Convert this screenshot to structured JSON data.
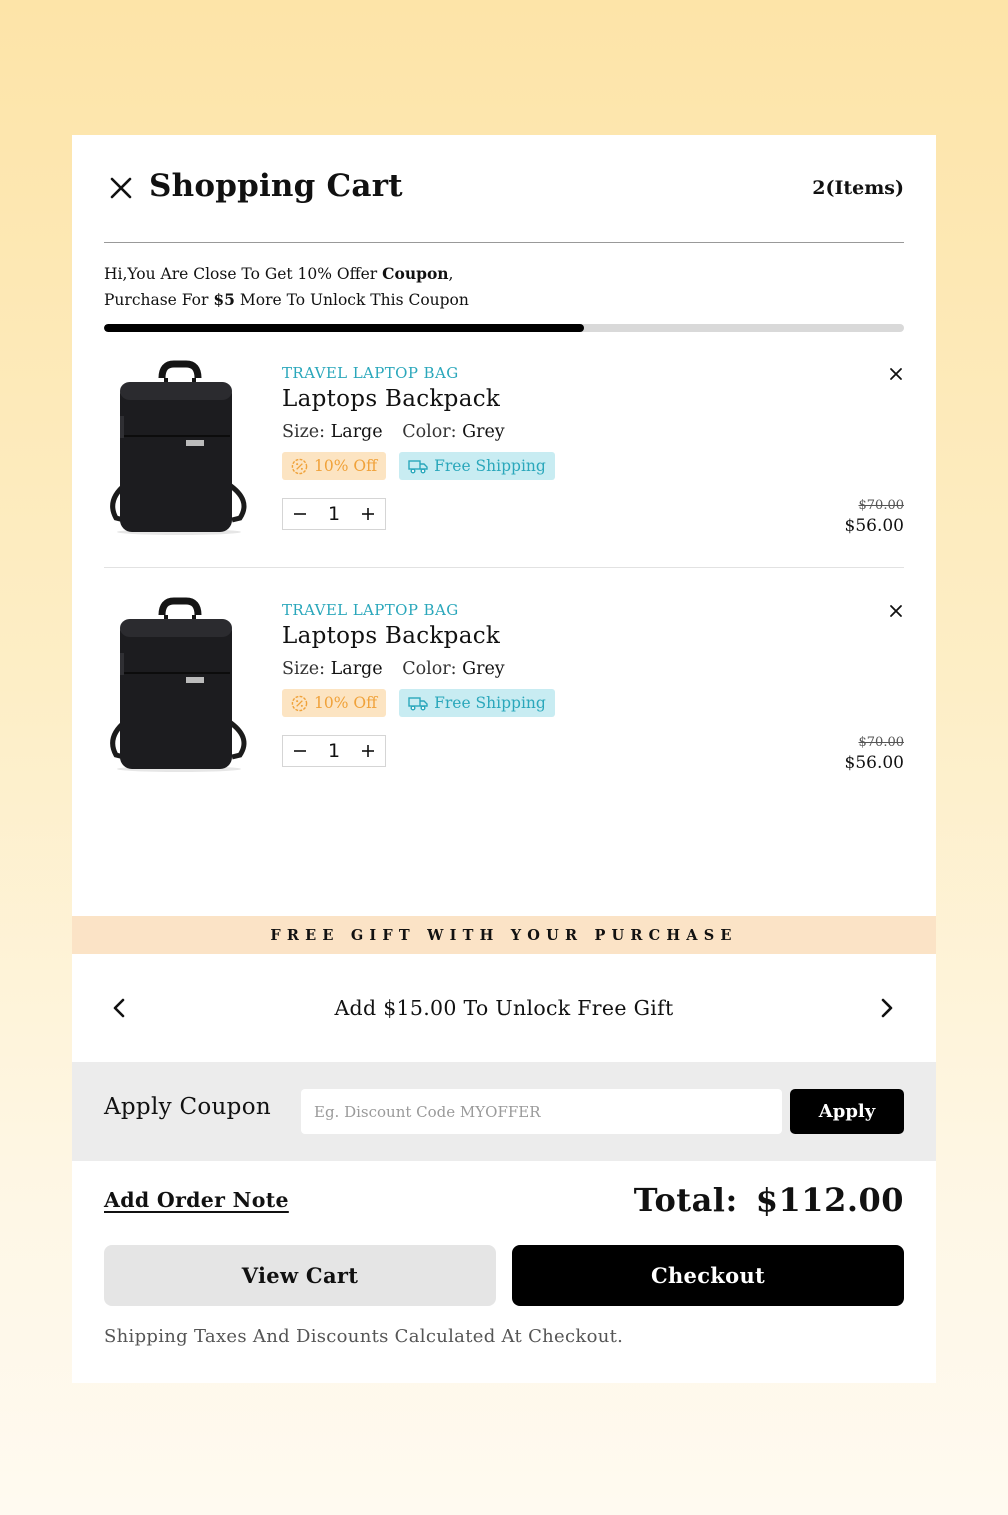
{
  "header": {
    "title": "Shopping Cart",
    "count": "2(Items)"
  },
  "promo": {
    "line1_prefix": "Hi,You Are Close To Get 10% Offer ",
    "line1_bold": "Coupon",
    "line1_suffix": ",",
    "line2_prefix": "Purchase For ",
    "line2_bold": "$5",
    "line2_suffix": " More To Unlock This Coupon",
    "progress": 0.6
  },
  "items": [
    {
      "category": "TRAVEL LAPTOP BAG",
      "name": "Laptops Backpack",
      "size_label": "Size:",
      "size": "Large",
      "color_label": "Color:",
      "color": "Grey",
      "badge_discount": "10% Off",
      "badge_shipping": "Free Shipping",
      "quantity": "1",
      "old_price": "$70.00",
      "price": "$56.00"
    },
    {
      "category": "TRAVEL LAPTOP BAG",
      "name": "Laptops Backpack",
      "size_label": "Size:",
      "size": "Large",
      "color_label": "Color:",
      "color": "Grey",
      "badge_discount": "10% Off",
      "badge_shipping": "Free Shipping",
      "quantity": "1",
      "old_price": "$70.00",
      "price": "$56.00"
    }
  ],
  "gift": {
    "banner": "FREE GIFT WITH YOUR PURCHASE",
    "message": "Add $15.00 To Unlock Free Gift"
  },
  "coupon": {
    "label": "Apply Coupon",
    "placeholder": "Eg. Discount Code MYOFFER",
    "button": "Apply"
  },
  "footer": {
    "note_link": "Add Order Note",
    "total_label": "Total:",
    "total_value": "$112.00",
    "view_cart": "View Cart",
    "checkout": "Checkout",
    "disclaimer": "Shipping Taxes And Discounts Calculated At Checkout."
  },
  "colors": {
    "accent_teal": "#2aa7bb",
    "discount_orange": "#f0a23a",
    "discount_bg": "#fce4c2",
    "shipping_bg": "#c8ecf2",
    "gift_banner_bg": "#fbe3c6"
  }
}
